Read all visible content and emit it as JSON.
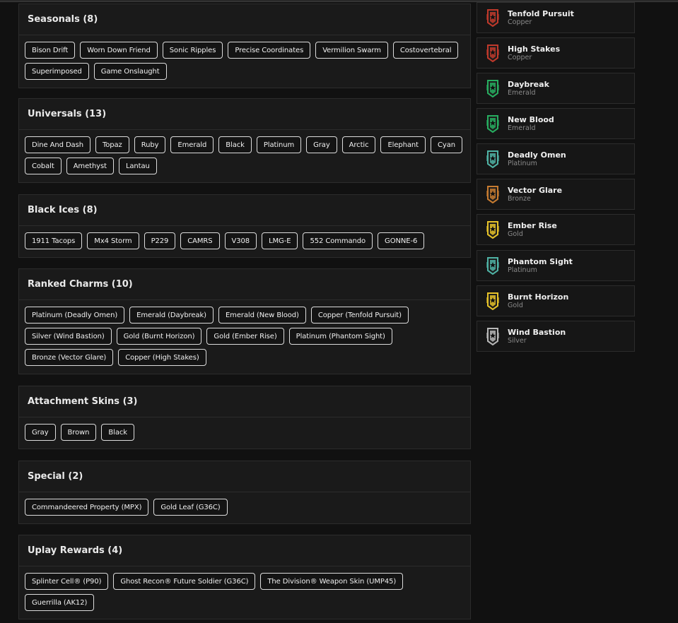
{
  "sections": [
    {
      "title": "Seasonals (8)",
      "items": [
        "Bison Drift",
        "Worn Down Friend",
        "Sonic Ripples",
        "Precise Coordinates",
        "Vermilion Swarm",
        "Costovertebral",
        "Superimposed",
        "Game Onslaught"
      ]
    },
    {
      "title": "Universals (13)",
      "items": [
        "Dine And Dash",
        "Topaz",
        "Ruby",
        "Emerald",
        "Black",
        "Platinum",
        "Gray",
        "Arctic",
        "Elephant",
        "Cyan",
        "Cobalt",
        "Amethyst",
        "Lantau"
      ]
    },
    {
      "title": "Black Ices (8)",
      "items": [
        "1911 Tacops",
        "Mx4 Storm",
        "P229",
        "CAMRS",
        "V308",
        "LMG-E",
        "552 Commando",
        "GONNE-6"
      ]
    },
    {
      "title": "Ranked Charms (10)",
      "items": [
        "Platinum (Deadly Omen)",
        "Emerald (Daybreak)",
        "Emerald (New Blood)",
        "Copper (Tenfold Pursuit)",
        "Silver (Wind Bastion)",
        "Gold (Burnt Horizon)",
        "Gold (Ember Rise)",
        "Platinum (Phantom Sight)",
        "Bronze (Vector Glare)",
        "Copper (High Stakes)"
      ]
    },
    {
      "title": "Attachment Skins (3)",
      "items": [
        "Gray",
        "Brown",
        "Black"
      ]
    },
    {
      "title": "Special (2)",
      "items": [
        "Commandeered Property (MPX)",
        "Gold Leaf (G36C)"
      ]
    },
    {
      "title": "Uplay Rewards (4)",
      "items": [
        "Splinter Cell® (P90)",
        "Ghost Recon® Future Soldier (G36C)",
        "The Division® Weapon Skin (UMP45)",
        "Guerrilla (AK12)"
      ]
    }
  ],
  "charms": [
    {
      "name": "Tenfold Pursuit",
      "tier": "Copper",
      "color": "#c0392b",
      "icon": "copper-rank-icon"
    },
    {
      "name": "High Stakes",
      "tier": "Copper",
      "color": "#c0392b",
      "icon": "copper-rank-icon"
    },
    {
      "name": "Daybreak",
      "tier": "Emerald",
      "color": "#27ae60",
      "icon": "emerald-rank-icon"
    },
    {
      "name": "New Blood",
      "tier": "Emerald",
      "color": "#27ae60",
      "icon": "emerald-rank-icon"
    },
    {
      "name": "Deadly Omen",
      "tier": "Platinum",
      "color": "#4fb3a5",
      "icon": "platinum-rank-icon"
    },
    {
      "name": "Vector Glare",
      "tier": "Bronze",
      "color": "#c77b30",
      "icon": "bronze-rank-icon"
    },
    {
      "name": "Ember Rise",
      "tier": "Gold",
      "color": "#e6c229",
      "icon": "gold-rank-icon"
    },
    {
      "name": "Phantom Sight",
      "tier": "Platinum",
      "color": "#4fb3a5",
      "icon": "platinum-rank-icon"
    },
    {
      "name": "Burnt Horizon",
      "tier": "Gold",
      "color": "#e6c229",
      "icon": "gold-rank-icon"
    },
    {
      "name": "Wind Bastion",
      "tier": "Silver",
      "color": "#b8b8b8",
      "icon": "silver-rank-icon"
    }
  ]
}
